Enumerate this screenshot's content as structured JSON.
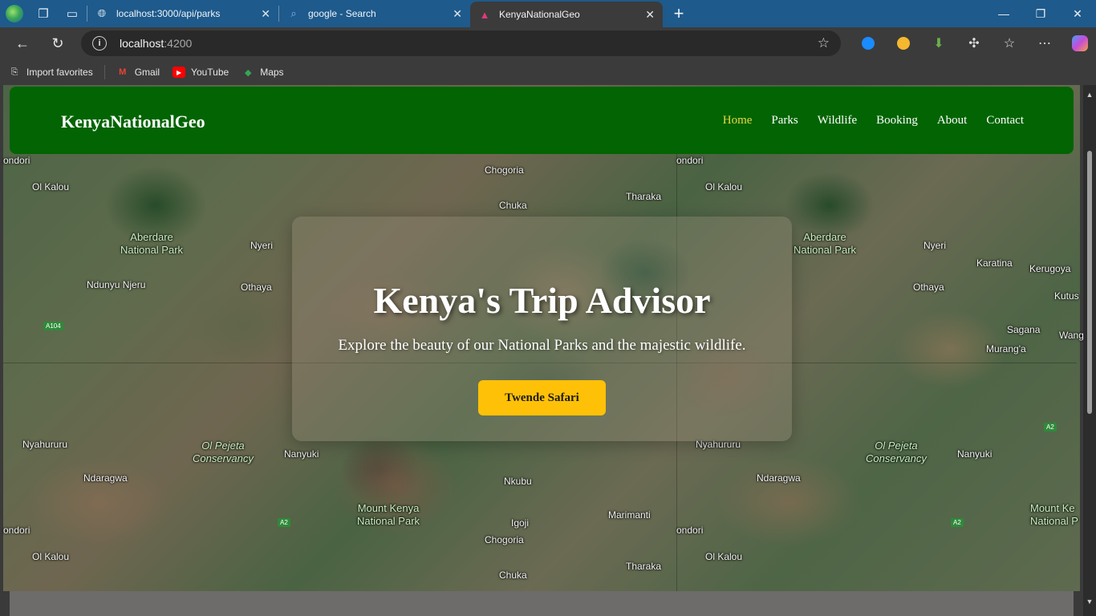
{
  "browser": {
    "tabs": [
      {
        "title": "localhost:3000/api/parks",
        "icon": "globe-icon"
      },
      {
        "title": "google - Search",
        "icon": "search-icon"
      },
      {
        "title": "KenyaNationalGeo",
        "icon": "angular-icon",
        "active": true
      }
    ],
    "address": {
      "host": "localhost",
      "port": ":4200"
    },
    "bookmarks": [
      {
        "label": "Import favorites",
        "icon": "import-icon"
      },
      {
        "label": "Gmail",
        "icon": "gmail-icon"
      },
      {
        "label": "YouTube",
        "icon": "youtube-icon"
      },
      {
        "label": "Maps",
        "icon": "maps-icon"
      }
    ]
  },
  "site": {
    "brand": "KenyaNationalGeo",
    "nav": [
      "Home",
      "Parks",
      "Wildlife",
      "Booking",
      "About",
      "Contact"
    ],
    "active_nav": "Home",
    "hero": {
      "title": "Kenya's Trip Advisor",
      "subtitle": "Explore the beauty of our National Parks and the majestic wildlife.",
      "cta": "Twende Safari"
    }
  },
  "map_labels": [
    {
      "text": "ondori"
    },
    {
      "text": "Ol Kalou"
    },
    {
      "text": "Chogoria"
    },
    {
      "text": "Tharaka"
    },
    {
      "text": "Chuka"
    },
    {
      "text": "Aberdare\nNational Park"
    },
    {
      "text": "Nyeri"
    },
    {
      "text": "Ndunyu Njeru"
    },
    {
      "text": "Othaya"
    },
    {
      "text": "Karatina"
    },
    {
      "text": "Kerugoya"
    },
    {
      "text": "Kutus"
    },
    {
      "text": "Sagana"
    },
    {
      "text": "Murang'a"
    },
    {
      "text": "Wang"
    },
    {
      "text": "Nyahururu"
    },
    {
      "text": "Ol Pejeta\nConservancy"
    },
    {
      "text": "Nanyuki"
    },
    {
      "text": "Ndaragwa"
    },
    {
      "text": "Nkubu"
    },
    {
      "text": "Mount Kenya\nNational Park"
    },
    {
      "text": "Marimanti"
    },
    {
      "text": "Igoji"
    },
    {
      "text": "Mount Ke\nNational P"
    },
    {
      "text": "A104"
    },
    {
      "text": "A2"
    }
  ],
  "colors": {
    "navbar": "#026402",
    "active_nav": "#e6d84a",
    "cta": "#ffc107",
    "tabstrip": "#1e5a8c"
  }
}
